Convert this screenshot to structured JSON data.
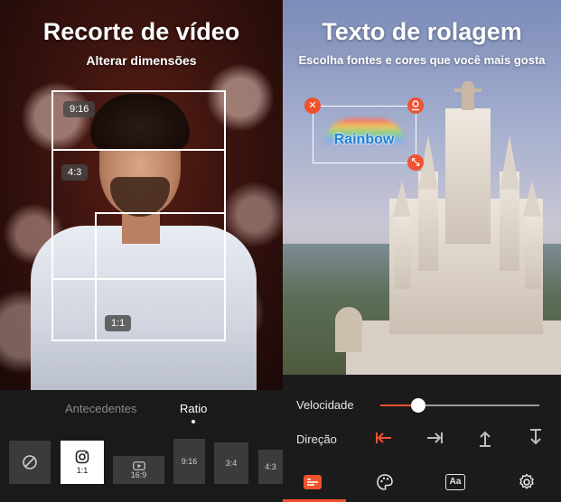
{
  "left_panel": {
    "title": "Recorte de vídeo",
    "subtitle": "Alterar dimensões",
    "frame_tags": {
      "ratio_9_16": "9:16",
      "ratio_4_3": "4:3",
      "ratio_1_1": "1:1"
    },
    "tabs": {
      "antecedentes": "Antecedentes",
      "ratio": "Ratio",
      "active": "Ratio"
    },
    "ratio_options": {
      "none_icon": "no-ratio-icon",
      "instagram": "1:1",
      "ratio_16_9": "16:9",
      "ratio_9_16": "9:16",
      "ratio_3_4": "3:4",
      "ratio_4_3": "4:3",
      "selected": "1:1"
    }
  },
  "right_panel": {
    "title": "Texto de rolagem",
    "subtitle": "Escolha fontes e cores que você mais gosta",
    "text_sticker": "Rainbow",
    "speed_label": "Velocidade",
    "speed_value": 0.24,
    "direction_label": "Direção",
    "direction_selected": "left",
    "accent_color": "#f0522d",
    "bottom_nav": {
      "items": [
        "text-list-icon",
        "palette-icon",
        "font-icon",
        "settings-icon"
      ],
      "font_glyph": "Aa",
      "active_index": 0
    }
  }
}
